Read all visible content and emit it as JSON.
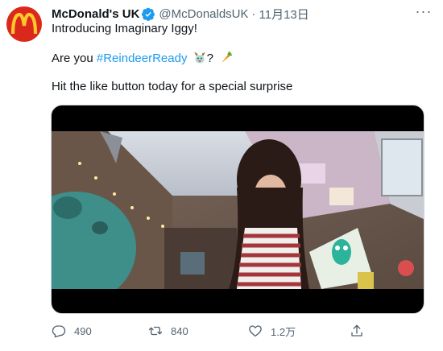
{
  "tweet": {
    "display_name": "McDonald's UK",
    "handle": "@McDonaldsUK",
    "separator": "·",
    "date": "11月13日",
    "line1": "Introducing Imaginary Iggy!",
    "line2_prefix": "Are you ",
    "hashtag": "#ReindeerReady",
    "line2_suffix": "?",
    "line3": "Hit the like button today for a special surprise"
  },
  "actions": {
    "reply_count": "490",
    "retweet_count": "840",
    "like_count": "1.2万"
  },
  "icons": {
    "avatar": "mcdonalds-golden-arches-logo",
    "verified": "verified-badge-icon",
    "more": "more-dots-icon",
    "reply": "reply-icon",
    "retweet": "retweet-icon",
    "like": "heart-icon",
    "share": "share-icon"
  },
  "colors": {
    "brand_red": "#da291c",
    "arches_yellow": "#ffc72c",
    "link_blue": "#1d9bf0",
    "muted_gray": "#536471"
  }
}
